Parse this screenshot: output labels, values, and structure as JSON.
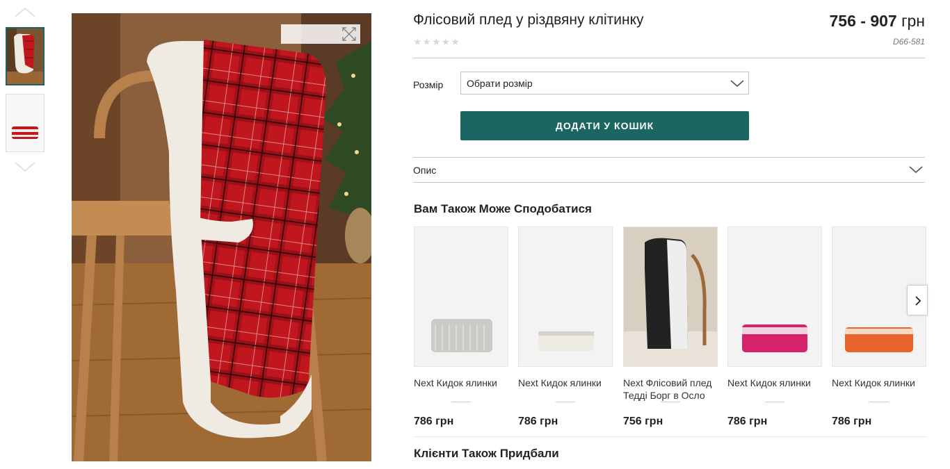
{
  "product": {
    "title": "Флісовий плед у різдвяну клітинку",
    "rating_stars": "★★★★★",
    "price_range": "756 - 907",
    "currency": "грн",
    "code": "D66-581"
  },
  "size": {
    "label": "Розмір",
    "selected": "Обрати розмір"
  },
  "add_to_cart_label": "ДОДАТИ У КОШИК",
  "description_label": "Опис",
  "recommendations": {
    "title": "Вам Також Може Сподобатися",
    "items": [
      {
        "name": "Next Кидок ялинки",
        "price": "786 грн",
        "color": "#c9cbc6"
      },
      {
        "name": "Next Кидок ялинки",
        "price": "786 грн",
        "color": "#eeeae4"
      },
      {
        "name": "Next Флісовий плед Тедді Борг в Осло",
        "price": "756 грн",
        "color": "#222222"
      },
      {
        "name": "Next Кидок ялинки",
        "price": "786 грн",
        "color": "#d6246c"
      },
      {
        "name": "Next Кидок ялинки",
        "price": "786 грн",
        "color": "#e7652c"
      }
    ]
  },
  "also_bought_title": "Клієнти Також Придбали",
  "colors": {
    "accent": "#1b6660",
    "plaid_red": "#c0161e",
    "sherpa": "#efeae2",
    "wood": "#a06a35"
  },
  "icons": {
    "zoom": "expand-icon",
    "dropdown": "chevron-down-icon",
    "next": "chevron-right-icon"
  }
}
